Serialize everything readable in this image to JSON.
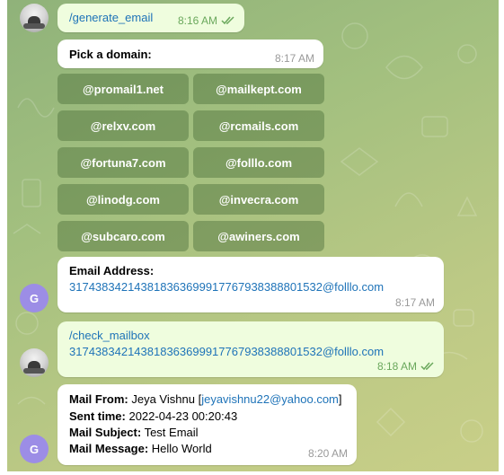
{
  "messages": {
    "cmd_generate": {
      "text": "/generate_email",
      "time": "8:16 AM"
    },
    "pick_domain": {
      "text": "Pick a domain:",
      "time": "8:17 AM"
    },
    "domain_buttons": [
      "@promail1.net",
      "@mailkept.com",
      "@relxv.com",
      "@rcmails.com",
      "@fortuna7.com",
      "@folllo.com",
      "@linodg.com",
      "@invecra.com",
      "@subcaro.com",
      "@awiners.com"
    ],
    "email_address": {
      "label": "Email Address:",
      "address": "317438342143818363699917767938388801532@folllo.com",
      "time": "8:17 AM"
    },
    "cmd_check": {
      "command": "/check_mailbox",
      "address": "317438342143818363699917767938388801532@folllo.com",
      "time": "8:18 AM"
    },
    "mail": {
      "from_label": "Mail From:",
      "from_name": "Jeya Vishnu",
      "from_bracket_open": "[",
      "from_email": "jeyavishnu22@yahoo.com",
      "from_bracket_close": "]",
      "sent_label": "Sent time:",
      "sent_value": "2022-04-23 00:20:43",
      "subject_label": "Mail Subject:",
      "subject_value": "Test Email",
      "message_label": "Mail Message:",
      "message_value": "Hello World",
      "time": "8:20 AM"
    }
  },
  "avatars": {
    "bot_letter": "G"
  },
  "colors": {
    "incoming_bubble": "#ffffff",
    "outgoing_bubble": "#effdde",
    "link": "#1e73b8",
    "bot_avatar": "#9c8de6",
    "read_ticks": "#6aa85c"
  },
  "icons": {
    "read_receipt": "double-check-icon",
    "user_avatar": "user-photo-avatar",
    "bot_avatar": "letter-avatar"
  }
}
